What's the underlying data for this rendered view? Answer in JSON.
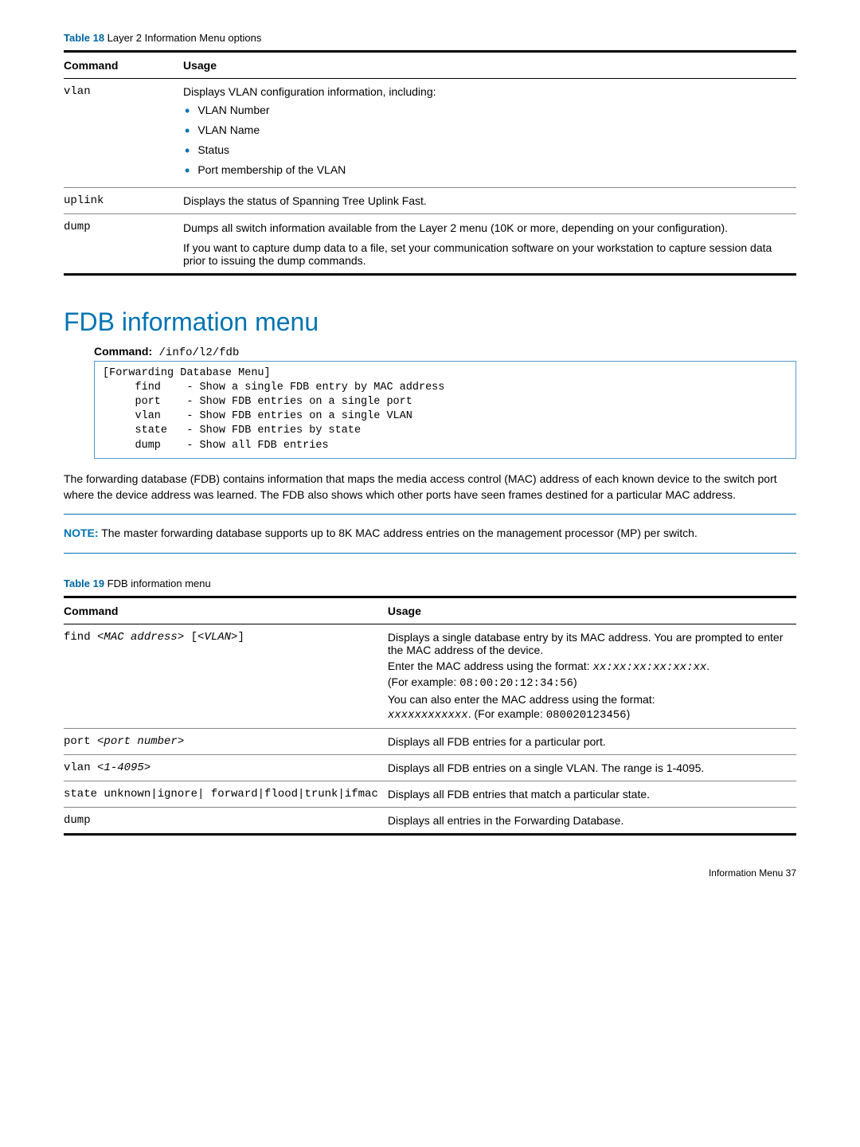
{
  "table18": {
    "caption_num": "Table 18",
    "caption_text": "  Layer 2 Information Menu options",
    "head": {
      "c1": "Command",
      "c2": "Usage"
    },
    "rows": [
      {
        "cmd": "vlan",
        "usage_lead": "Displays VLAN configuration information, including:",
        "bullets": [
          "VLAN Number",
          "VLAN Name",
          "Status",
          "Port membership of the VLAN"
        ]
      },
      {
        "cmd": "uplink",
        "usage_text": "Displays the status of Spanning Tree Uplink Fast."
      },
      {
        "cmd": "dump",
        "usage_p1": "Dumps all switch information available from the Layer 2 menu (10K or more, depending on your configuration).",
        "usage_p2": "If you want to capture dump data to a file, set your communication software on your workstation to capture session data prior to issuing the dump commands."
      }
    ]
  },
  "section": {
    "title": "FDB information menu",
    "command_label": "Command:",
    "command_value": " /info/l2/fdb",
    "code_block": "[Forwarding Database Menu]\n     find    - Show a single FDB entry by MAC address\n     port    - Show FDB entries on a single port\n     vlan    - Show FDB entries on a single VLAN\n     state   - Show FDB entries by state\n     dump    - Show all FDB entries",
    "para1": "The forwarding database (FDB) contains information that maps the media access control (MAC) address of each known device to the switch port where the device address was learned. The FDB also shows which other ports have seen frames destined for a particular MAC address.",
    "note_label": "NOTE:",
    "note_text": " The master forwarding database supports up to 8K MAC address entries on the management processor (MP) per switch."
  },
  "table19": {
    "caption_num": "Table 19",
    "caption_text": "  FDB information menu",
    "head": {
      "c1": "Command",
      "c2": "Usage"
    },
    "rows": {
      "r0": {
        "cmd_pre": "find ",
        "cmd_arg1": "<MAC address>",
        "cmd_mid": " [",
        "cmd_arg2": "<VLAN>",
        "cmd_post": "]",
        "p1": "Displays a single database entry by its MAC address. You are prompted to enter the MAC address of the device.",
        "p2a": "Enter the MAC address using the format: ",
        "p2b": "xx:xx:xx:xx:xx:xx",
        "p2c": ".",
        "p3a": "(For example: ",
        "p3b": "08:00:20:12:34:56",
        "p3c": ")",
        "p4": "You can also enter the MAC address using the format: ",
        "p5a": "xxxxxxxxxxxx",
        "p5b": ". (For example: ",
        "p5c": "080020123456",
        "p5d": ")"
      },
      "r1": {
        "cmd_pre": "port ",
        "cmd_arg": "<port number>",
        "usage": "Displays all FDB entries for a particular port."
      },
      "r2": {
        "cmd_pre": "vlan ",
        "cmd_arg": "<1-4095>",
        "usage": "Displays all FDB entries on a single VLAN. The range is 1-4095."
      },
      "r3": {
        "cmd": "state unknown|ignore| forward|flood|trunk|ifmac",
        "usage": "Displays all FDB entries that match a particular state."
      },
      "r4": {
        "cmd": "dump",
        "usage": "Displays all entries in the Forwarding Database."
      }
    }
  },
  "footer": "Information Menu   37"
}
